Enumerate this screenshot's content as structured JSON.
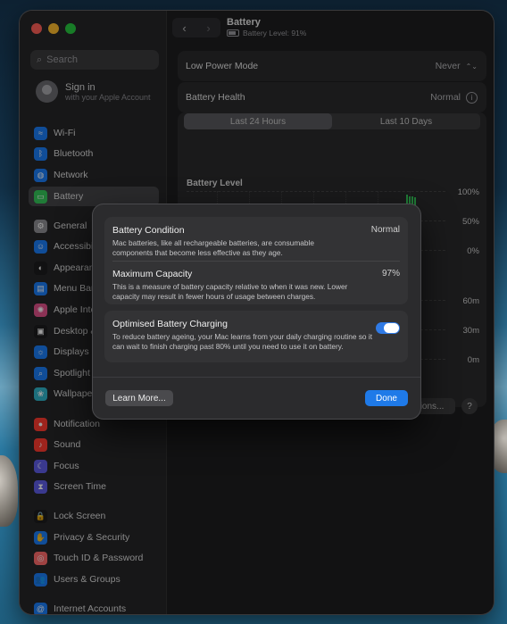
{
  "window": {
    "title": "Battery",
    "subtitle": "Battery Level: 91%",
    "back_icon": "chevron-left",
    "forward_icon": "chevron-right"
  },
  "sidebar": {
    "search_placeholder": "Search",
    "signin": {
      "title": "Sign in",
      "subtitle": "with your Apple Account"
    },
    "items": [
      {
        "label": "Wi-Fi",
        "icon": "wifi-icon",
        "color": "#1a7cf5",
        "glyph": "≈"
      },
      {
        "label": "Bluetooth",
        "icon": "bluetooth-icon",
        "color": "#1a7cf5",
        "glyph": "ᛒ"
      },
      {
        "label": "Network",
        "icon": "globe-icon",
        "color": "#1a7cf5",
        "glyph": "◍"
      },
      {
        "label": "Battery",
        "icon": "battery-icon",
        "color": "#34c759",
        "glyph": "▭",
        "selected": true
      },
      {
        "label": "General",
        "icon": "gear-icon",
        "color": "#8e8e93",
        "glyph": "⚙"
      },
      {
        "label": "Accessibil",
        "icon": "accessibility-icon",
        "color": "#1a7cf5",
        "glyph": "☺"
      },
      {
        "label": "Appearanc",
        "icon": "appearance-icon",
        "color": "#1c1c1e",
        "glyph": "◐"
      },
      {
        "label": "Menu Bar",
        "icon": "menubar-icon",
        "color": "#1a7cf5",
        "glyph": "▤"
      },
      {
        "label": "Apple Inte",
        "icon": "apple-intelligence-icon",
        "color": "#e0518a",
        "glyph": "✺"
      },
      {
        "label": "Desktop &",
        "icon": "desktop-icon",
        "color": "#1c1c1e",
        "glyph": "▣"
      },
      {
        "label": "Displays",
        "icon": "displays-icon",
        "color": "#1a7cf5",
        "glyph": "☼"
      },
      {
        "label": "Spotlight",
        "icon": "spotlight-icon",
        "color": "#1a7cf5",
        "glyph": "⌕"
      },
      {
        "label": "Wallpaper",
        "icon": "wallpaper-icon",
        "color": "#2fb3c9",
        "glyph": "❀"
      },
      {
        "label": "Notification",
        "icon": "notifications-icon",
        "color": "#ff3b30",
        "glyph": "●"
      },
      {
        "label": "Sound",
        "icon": "sound-icon",
        "color": "#ff3b30",
        "glyph": "♪"
      },
      {
        "label": "Focus",
        "icon": "focus-icon",
        "color": "#5e5ce6",
        "glyph": "☾"
      },
      {
        "label": "Screen Time",
        "icon": "screentime-icon",
        "color": "#5e5ce6",
        "glyph": "⧗"
      },
      {
        "label": "Lock Screen",
        "icon": "lock-icon",
        "color": "#1c1c1e",
        "glyph": "🔒"
      },
      {
        "label": "Privacy & Security",
        "icon": "privacy-hand-icon",
        "color": "#1a7cf5",
        "glyph": "✋"
      },
      {
        "label": "Touch ID & Password",
        "icon": "fingerprint-icon",
        "color": "#ff6b6b",
        "glyph": "◎"
      },
      {
        "label": "Users & Groups",
        "icon": "users-icon",
        "color": "#1a7cf5",
        "glyph": "👥"
      },
      {
        "label": "Internet Accounts",
        "icon": "at-icon",
        "color": "#1a7cf5",
        "glyph": "@"
      }
    ]
  },
  "main": {
    "low_power": {
      "label": "Low Power Mode",
      "value": "Never"
    },
    "health": {
      "label": "Battery Health",
      "value": "Normal"
    },
    "tabs": [
      {
        "label": "Last 24 Hours",
        "selected": true
      },
      {
        "label": "Last 10 Days",
        "selected": false
      }
    ],
    "chart": {
      "title": "Battery Level",
      "y_labels": [
        "100%",
        "50%",
        "0%"
      ],
      "usage_labels": [
        "60m",
        "30m",
        "0m"
      ]
    },
    "options_button": "Options...",
    "help_button": "?"
  },
  "modal": {
    "condition": {
      "title": "Battery Condition",
      "value": "Normal",
      "desc": "Mac batteries, like all rechargeable batteries, are consumable components that become less effective as they age."
    },
    "capacity": {
      "title": "Maximum Capacity",
      "value": "97%",
      "desc": "This is a measure of battery capacity relative to when it was new. Lower capacity may result in fewer hours of usage between charges."
    },
    "optimised": {
      "title": "Optimised Battery Charging",
      "enabled": true,
      "desc": "To reduce battery ageing, your Mac learns from your daily charging routine so it can wait to finish charging past 80% until you need to use it on battery."
    },
    "learn_more": "Learn More...",
    "done": "Done"
  },
  "colors": {
    "accent": "#1f7ae8",
    "window_bg": "#1e1e1f",
    "modal_bg": "#2b2b2d",
    "battery_green": "#34c759"
  }
}
